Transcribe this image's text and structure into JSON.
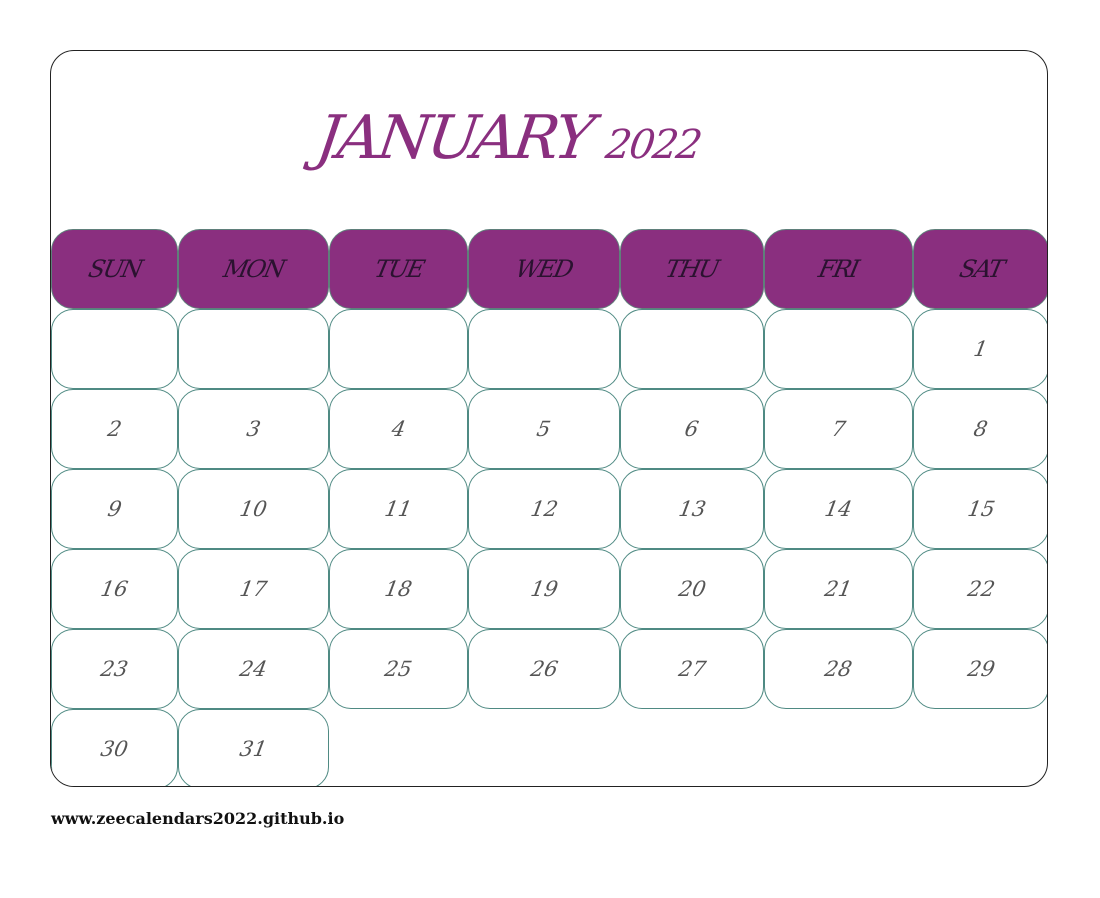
{
  "calendar": {
    "month": "JANUARY",
    "year": "2022",
    "weekdays": [
      "SUN",
      "MON",
      "TUE",
      "WED",
      "THU",
      "FRI",
      "SAT"
    ],
    "weeks": [
      [
        "",
        "",
        "",
        "",
        "",
        "",
        "1"
      ],
      [
        "2",
        "3",
        "4",
        "5",
        "6",
        "7",
        "8"
      ],
      [
        "9",
        "10",
        "11",
        "12",
        "13",
        "14",
        "15"
      ],
      [
        "16",
        "17",
        "18",
        "19",
        "20",
        "21",
        "22"
      ],
      [
        "23",
        "24",
        "25",
        "26",
        "27",
        "28",
        "29"
      ],
      [
        "30",
        "31"
      ]
    ],
    "colors": {
      "accent": "#8a2f7f",
      "cell_border": "#4f8a83"
    }
  },
  "footer": {
    "url": "www.zeecalendars2022.github.io"
  }
}
